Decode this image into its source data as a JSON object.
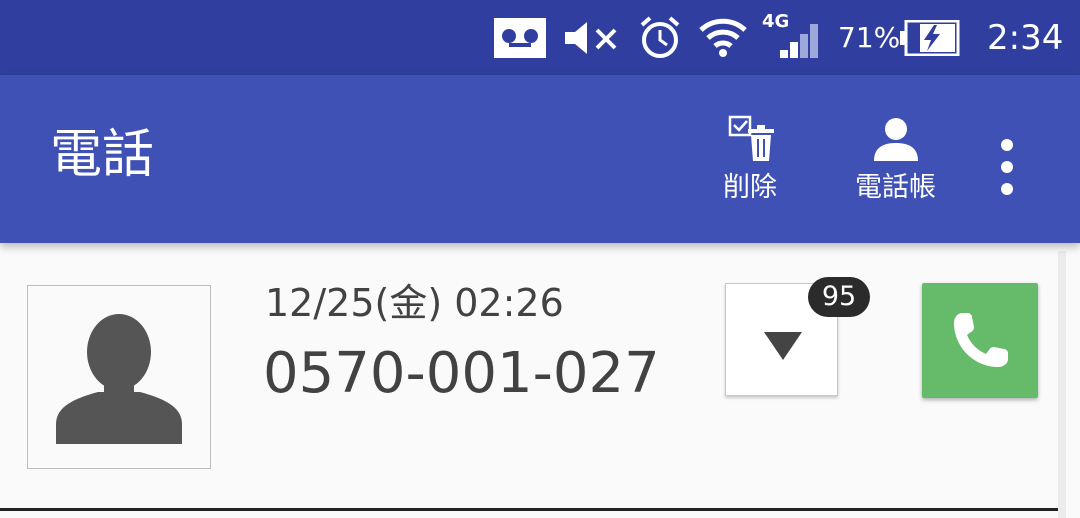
{
  "status_bar": {
    "icons": [
      "voicemail-icon",
      "mute-icon",
      "alarm-icon",
      "wifi-icon",
      "signal-4g-icon",
      "battery-charging-icon"
    ],
    "network_label": "4G",
    "battery_percent": "71%",
    "time": "2:34",
    "colors": {
      "background": "#303f9f"
    }
  },
  "app_bar": {
    "title": "電話",
    "actions": [
      {
        "label": "削除",
        "icon": "delete-select-icon"
      },
      {
        "label": "電話帳",
        "icon": "contacts-person-icon"
      }
    ],
    "overflow_icon": "more-vert-icon",
    "colors": {
      "background": "#3f51b5"
    }
  },
  "call_log": {
    "entries": [
      {
        "date": "12/25(金) 02:26",
        "number": "0570-001-027",
        "avatar_icon": "person-silhouette-icon",
        "count_badge": "95",
        "expand_icon": "triangle-down-icon",
        "call_icon": "phone-icon"
      }
    ],
    "colors": {
      "call_button": "#66bb6a",
      "text": "#424242"
    }
  }
}
